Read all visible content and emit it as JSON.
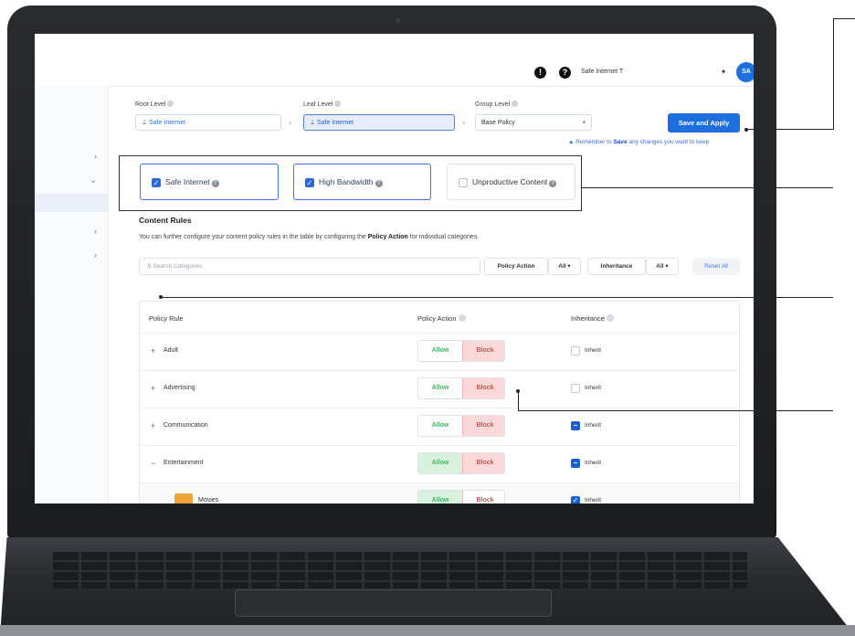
{
  "header": {
    "account_name": "Safe Internet T",
    "avatar_initials": "SA",
    "alert_icon": "alert-icon",
    "help_icon": "help-icon"
  },
  "levels": {
    "root_label": "Root Level",
    "root_value": "Safe Internet",
    "leaf_label": "Leaf Level",
    "leaf_value": "Safe Internet",
    "group_label": "Group Level",
    "group_value": "Base Policy"
  },
  "actions": {
    "save_apply": "Save and Apply",
    "reminder_pre": "Remember to ",
    "reminder_bold": "Save",
    "reminder_post": " any changes you want to keep"
  },
  "presets": [
    {
      "label": "Safe Internet",
      "checked": true
    },
    {
      "label": "High Bandwidth",
      "checked": true
    },
    {
      "label": "Unproductive Content",
      "checked": false
    }
  ],
  "content_rules": {
    "title": "Content Rules",
    "desc_pre": "You can further configure your content policy rules in the table by configuring the ",
    "desc_bold": "Policy Action",
    "desc_post": " for individual categories."
  },
  "filters": {
    "search_placeholder": "Search Categories",
    "policy_action_label": "Policy Action",
    "policy_action_value": "All",
    "inheritance_label": "Inheritance",
    "inheritance_value": "All",
    "reset_all": "Reset All"
  },
  "table": {
    "col_rule": "Policy Rule",
    "col_action": "Policy Action",
    "col_inherit": "Inheritance",
    "allow_label": "Allow",
    "block_label": "Block",
    "inherit_label": "Inherit",
    "rows": [
      {
        "expander": "+",
        "name": "Adult",
        "action": "Block",
        "inherit": false
      },
      {
        "expander": "+",
        "name": "Advertising",
        "action": "Block",
        "inherit": false
      },
      {
        "expander": "+",
        "name": "Communication",
        "action": "Block",
        "inherit": true
      },
      {
        "expander": "−",
        "name": "Entertainment",
        "action": "Allow+Block",
        "inherit": true
      },
      {
        "expander": "",
        "name": "Movies",
        "action": "Allow",
        "inherit": true
      }
    ]
  },
  "colors": {
    "primary": "#1d6fe0",
    "allow": "#49b15f",
    "block": "#d34d4d"
  }
}
